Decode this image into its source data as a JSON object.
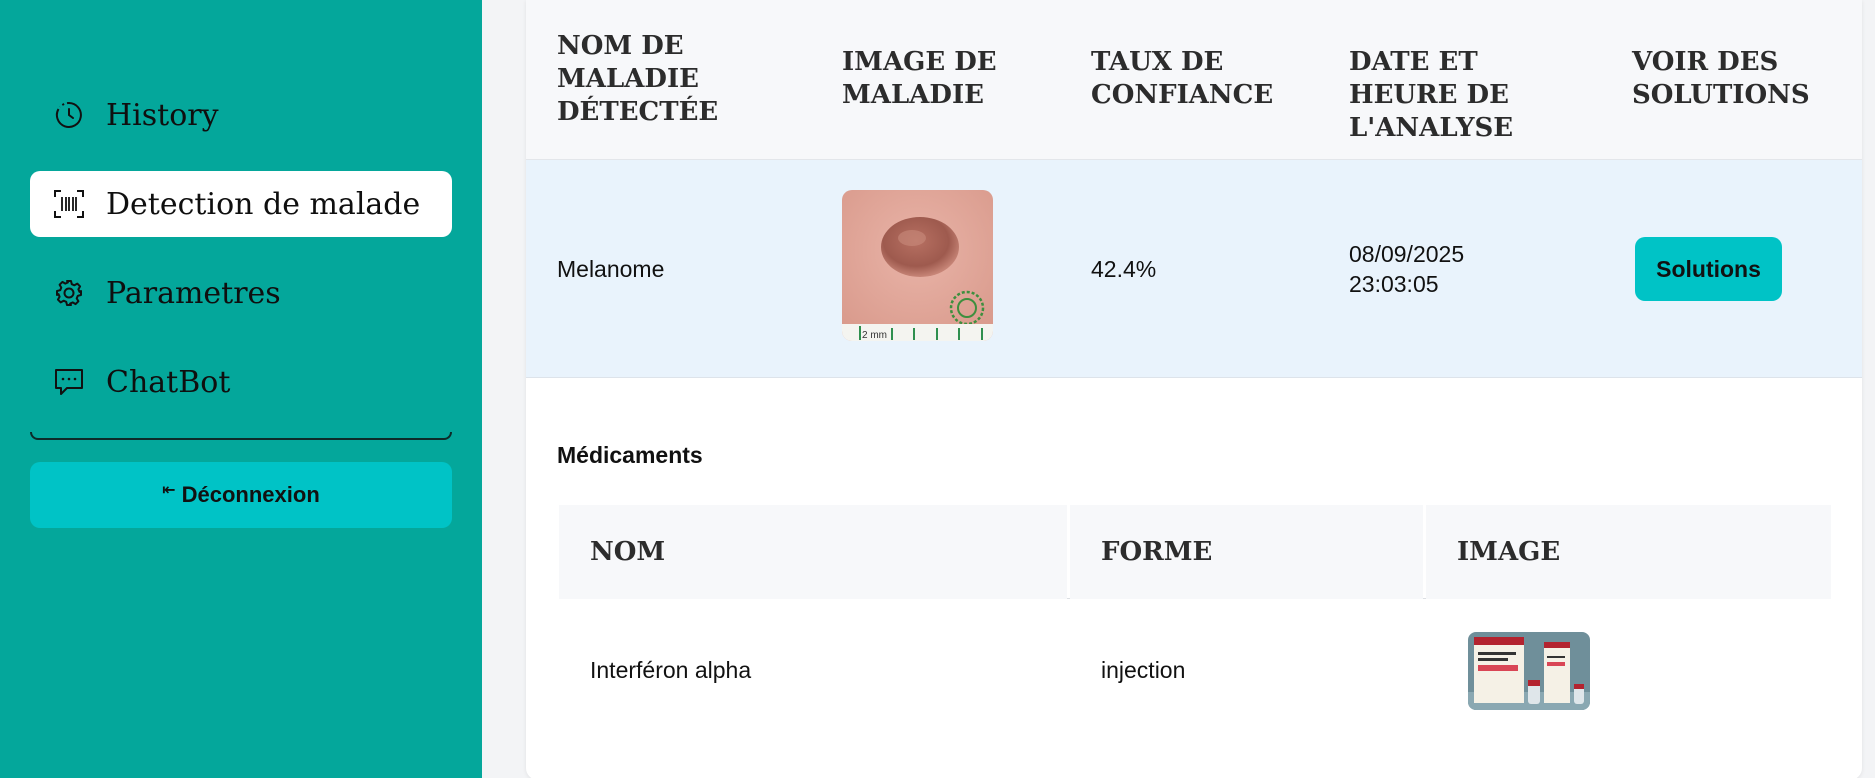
{
  "sidebar": {
    "items": [
      {
        "label": "History",
        "icon": "history-clock-icon",
        "active": false
      },
      {
        "label": "Detection de malade",
        "icon": "barcode-scan-icon",
        "active": true
      },
      {
        "label": "Parametres",
        "icon": "gear-icon",
        "active": false
      },
      {
        "label": "ChatBot",
        "icon": "chat-bubble-icon",
        "active": false
      }
    ],
    "logout_arrow": "⇤",
    "logout_label": "Déconnexion"
  },
  "detection_table": {
    "headers": {
      "name": "NOM DE MALADIE DÉTECTÉE",
      "image": "IMAGE DE MALADIE",
      "confidence": "TAUX DE CONFIANCE",
      "datetime": "DATE ET HEURE DE L'ANALYSE",
      "solutions": "VOIR DES SOLUTIONS"
    },
    "row": {
      "disease": "Melanome",
      "confidence": "42.4%",
      "date": "08/09/2025",
      "time": "23:03:05",
      "solutions_label": "Solutions",
      "ruler_label": "2 mm"
    }
  },
  "medicaments": {
    "title": "Médicaments",
    "headers": {
      "name": "NOM",
      "form": "FORME",
      "image": "IMAGE"
    },
    "rows": [
      {
        "name": "Interféron alpha",
        "form": "injection"
      }
    ]
  },
  "colors": {
    "sidebar_bg": "#04a79b",
    "accent_button": "#00c3c6",
    "row_highlight": "#e9f3fc"
  }
}
